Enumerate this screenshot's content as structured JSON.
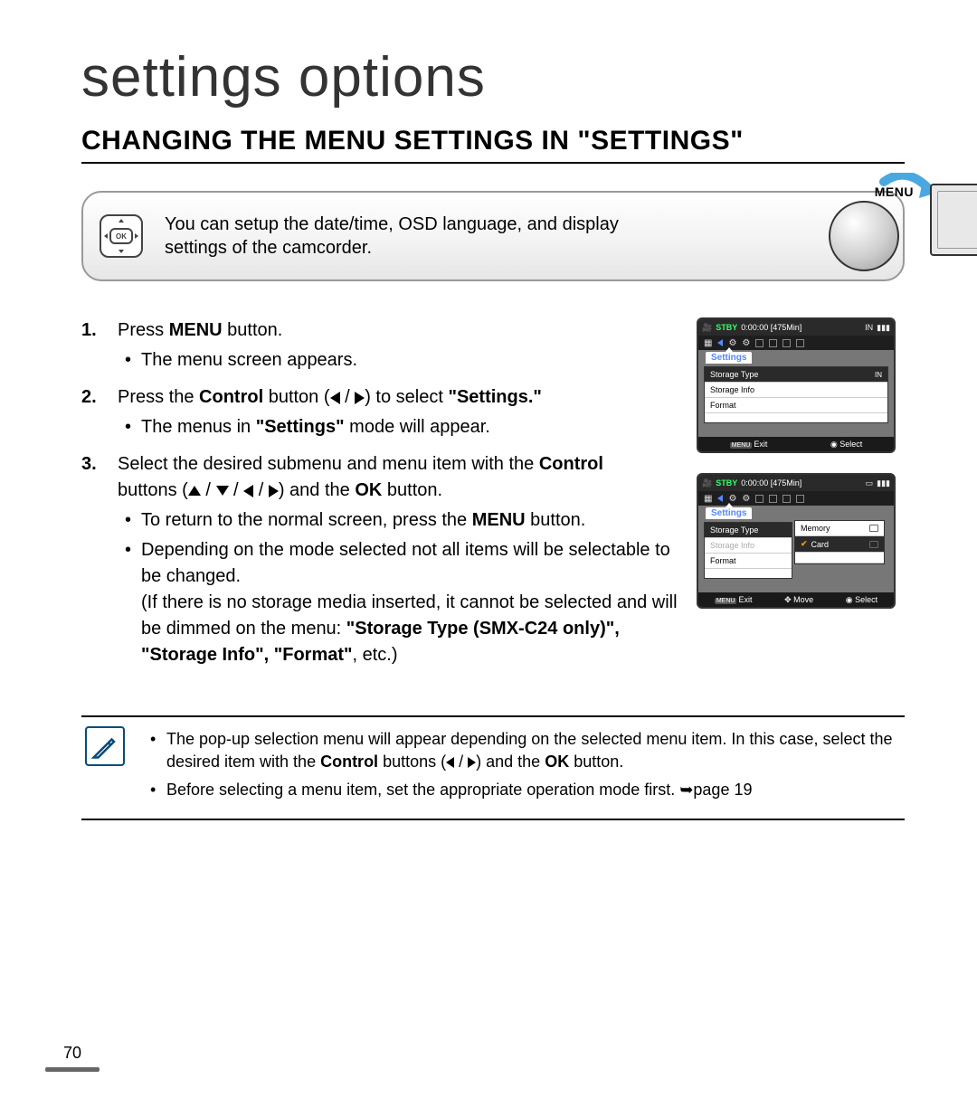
{
  "page": {
    "title": "settings options",
    "heading": "CHANGING THE MENU SETTINGS IN \"SETTINGS\"",
    "number": "70"
  },
  "intro": {
    "text": "You can setup the date/time, OSD language, and display settings of the camcorder.",
    "ok_label": "OK",
    "menu_label": "MENU"
  },
  "steps": [
    {
      "num": "1.",
      "prefix": "Press ",
      "bold": "MENU",
      "suffix": " button.",
      "subs": [
        "The menu screen appears."
      ]
    },
    {
      "num": "2.",
      "text_parts": {
        "a": "Press the ",
        "b": "Control",
        "c": " button (",
        "d": ") to select ",
        "e": "\"Settings.\""
      },
      "subs_bold": {
        "pre": "The menus in ",
        "b": "\"Settings\"",
        "post": " mode will appear."
      }
    },
    {
      "num": "3.",
      "line1": {
        "a": "Select the desired submenu and menu item with the ",
        "b": "Control"
      },
      "line2": {
        "a": "buttons (",
        "b": ") and the ",
        "c": "OK",
        "d": " button."
      },
      "subs": [
        {
          "a": "To return to the normal screen, press the ",
          "b": "MENU",
          "c": " button."
        }
      ],
      "sub_long": {
        "a": "Depending on the mode selected not all items will be selectable to be changed.",
        "b": "(If there is no storage media inserted, it cannot be selected and will be dimmed on the menu: ",
        "c": "\"Storage Type (SMX-C24 only)\", \"Storage Info\", \"Format\"",
        "d": ", etc.)"
      }
    }
  ],
  "shot1": {
    "stby": "STBY",
    "time": "0:00:00 [475Min]",
    "tab": "Settings",
    "rows": [
      "Storage Type",
      "Storage Info",
      "Format"
    ],
    "footer": {
      "exit_tag": "MENU",
      "exit": "Exit",
      "select": "Select"
    }
  },
  "shot2": {
    "stby": "STBY",
    "time": "0:00:00 [475Min]",
    "tab": "Settings",
    "rows": [
      "Storage Type",
      "Storage Info",
      "Format"
    ],
    "popup": [
      "Memory",
      "Card"
    ],
    "footer": {
      "exit_tag": "MENU",
      "exit": "Exit",
      "move": "Move",
      "select": "Select"
    }
  },
  "notes": {
    "n1": {
      "a": "The pop-up selection menu will appear depending on the selected menu item. In this case, select the desired item with the ",
      "b": "Control",
      "c": " buttons (",
      "d": ") and the ",
      "e": "OK",
      "f": " button."
    },
    "n2": {
      "a": "Before selecting a menu item, set the appropriate operation mode first. ",
      "b": "page 19"
    }
  }
}
